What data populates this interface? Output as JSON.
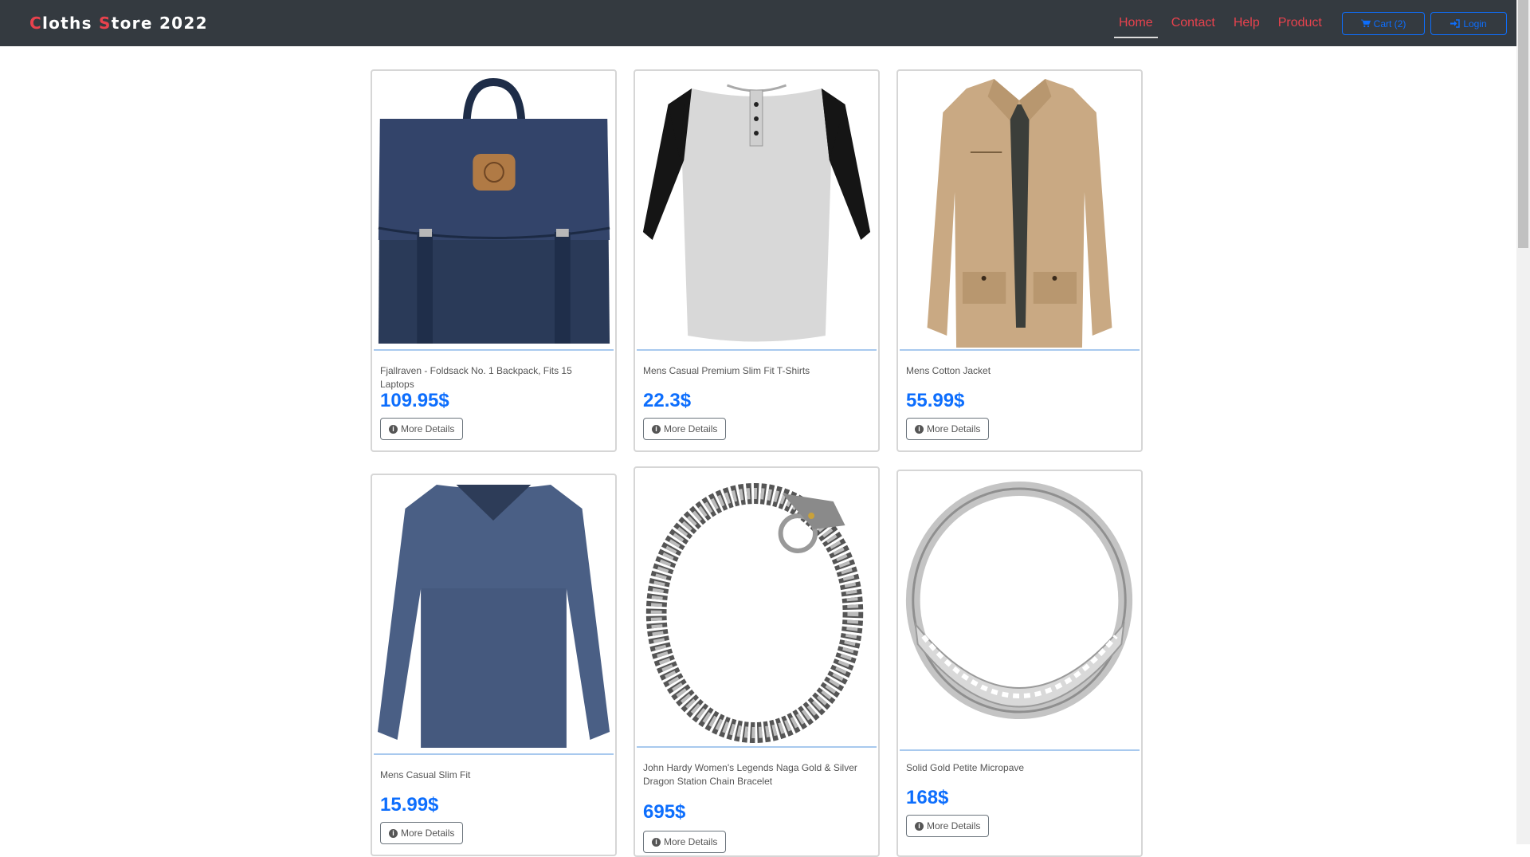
{
  "brand": {
    "first_letter": "C",
    "part1": "loths ",
    "second_letter": "S",
    "part2": "tore 2022"
  },
  "nav": {
    "links": [
      {
        "label": "Home",
        "active": true
      },
      {
        "label": "Contact",
        "active": false
      },
      {
        "label": "Help",
        "active": false
      },
      {
        "label": "Product",
        "active": false
      }
    ],
    "cart_label": "Cart (2)",
    "login_label": "Login"
  },
  "colors": {
    "navbar_bg": "#343a40",
    "accent_red": "#e8424d",
    "link_blue": "#0d6efd"
  },
  "products": [
    {
      "title": "Fjallraven - Foldsack No. 1 Backpack, Fits 15 Laptops",
      "price": "109.95$",
      "button": "More Details",
      "image": "navy-backpack"
    },
    {
      "title": "Mens Casual Premium Slim Fit T-Shirts",
      "price": "22.3$",
      "button": "More Details",
      "image": "raglan-tshirt"
    },
    {
      "title": "Mens Cotton Jacket",
      "price": "55.99$",
      "button": "More Details",
      "image": "tan-jacket"
    },
    {
      "title": "Mens Casual Slim Fit",
      "price": "15.99$",
      "button": "More Details",
      "image": "blue-longsleeve"
    },
    {
      "title": "John Hardy Women's Legends Naga Gold & Silver Dragon Station Chain Bracelet",
      "price": "695$",
      "button": "More Details",
      "image": "dragon-bracelet"
    },
    {
      "title": "Solid Gold Petite Micropave",
      "price": "168$",
      "button": "More Details",
      "image": "silver-ring"
    }
  ]
}
